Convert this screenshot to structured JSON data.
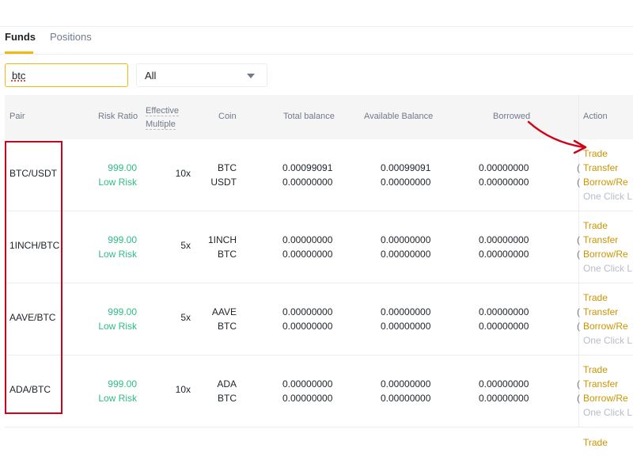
{
  "tabs": {
    "funds": "Funds",
    "positions": "Positions"
  },
  "search": {
    "value": "btc",
    "placeholder": ""
  },
  "filter": {
    "value": "All"
  },
  "columns": {
    "pair": "Pair",
    "risk_ratio": "Risk Ratio",
    "effective_line1": "Effective",
    "effective_line2": "Multiple",
    "coin": "Coin",
    "total_balance": "Total balance",
    "available_balance": "Available Balance",
    "borrowed": "Borrowed",
    "action": "Action"
  },
  "rows": [
    {
      "pair": "BTC/USDT",
      "risk": "999.00",
      "risk_level": "Low Risk",
      "multiple": "10x",
      "coin1": "BTC",
      "coin2": "USDT",
      "total1": "0.00099091",
      "total2": "0.00000000",
      "avail1": "0.00099091",
      "avail2": "0.00000000",
      "borr1": "0.00000000",
      "borr2": "0.00000000",
      "clip1": "(",
      "clip2": "(",
      "trade": "Trade",
      "transfer": "Transfer",
      "borrow": "Borrow/Re",
      "one_click": "One Click L"
    },
    {
      "pair": "1INCH/BTC",
      "risk": "999.00",
      "risk_level": "Low Risk",
      "multiple": "5x",
      "coin1": "1INCH",
      "coin2": "BTC",
      "total1": "0.00000000",
      "total2": "0.00000000",
      "avail1": "0.00000000",
      "avail2": "0.00000000",
      "borr1": "0.00000000",
      "borr2": "0.00000000",
      "clip1": "(",
      "clip2": "(",
      "trade": "Trade",
      "transfer": "Transfer",
      "borrow": "Borrow/Re",
      "one_click": "One Click L"
    },
    {
      "pair": "AAVE/BTC",
      "risk": "999.00",
      "risk_level": "Low Risk",
      "multiple": "5x",
      "coin1": "AAVE",
      "coin2": "BTC",
      "total1": "0.00000000",
      "total2": "0.00000000",
      "avail1": "0.00000000",
      "avail2": "0.00000000",
      "borr1": "0.00000000",
      "borr2": "0.00000000",
      "clip1": "(",
      "clip2": "(",
      "trade": "Trade",
      "transfer": "Transfer",
      "borrow": "Borrow/Re",
      "one_click": "One Click L"
    },
    {
      "pair": "ADA/BTC",
      "risk": "999.00",
      "risk_level": "Low Risk",
      "multiple": "10x",
      "coin1": "ADA",
      "coin2": "BTC",
      "total1": "0.00000000",
      "total2": "0.00000000",
      "avail1": "0.00000000",
      "avail2": "0.00000000",
      "borr1": "0.00000000",
      "borr2": "0.00000000",
      "clip1": "(",
      "clip2": "(",
      "trade": "Trade",
      "transfer": "Transfer",
      "borrow": "Borrow/Re",
      "one_click": "One Click L"
    }
  ],
  "last_row_action": "Trade",
  "colors": {
    "accent": "#f0b90b",
    "action_text": "#c99400",
    "low_risk": "#2ebd85",
    "annotation": "#d0021b"
  },
  "icons": {
    "dropdown": "chevron-down-icon",
    "annotation_arrow": "arrow-icon"
  }
}
